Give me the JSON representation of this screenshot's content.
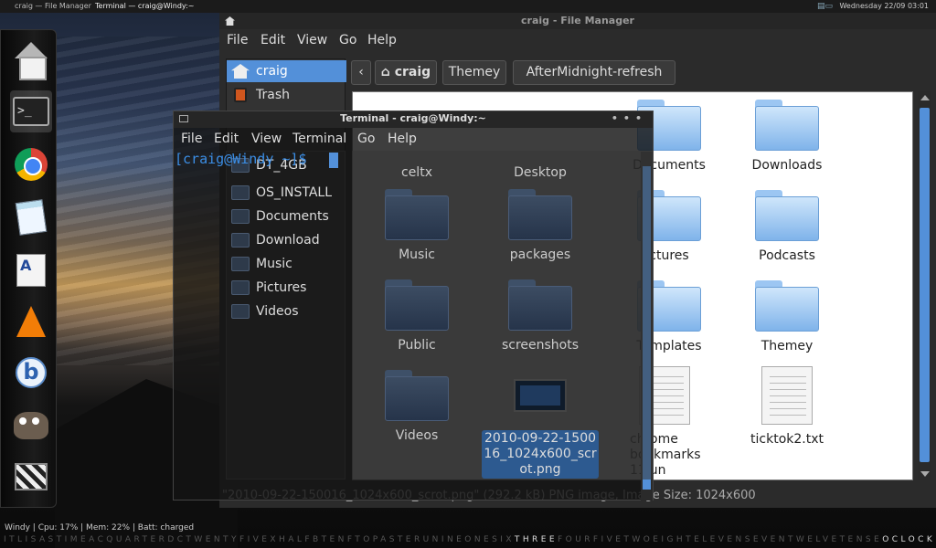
{
  "topbar": {
    "left1": "craig — File Manager",
    "left2": "Terminal — craig@Windy:~",
    "clock": "Wednesday 22/09 03:01"
  },
  "fm": {
    "title": "craig - File Manager",
    "menu": [
      "File",
      "Edit",
      "View",
      "Go",
      "Help"
    ],
    "sidebar": [
      "craig",
      "Trash"
    ],
    "path": {
      "back": "‹",
      "home": "craig",
      "b1": "Themey",
      "b2": "AfterMidnight-refresh"
    },
    "items_top": [
      "Documents",
      "Downloads"
    ],
    "items_row2": [
      "ctures",
      "Podcasts"
    ],
    "items_row3": [
      "Templates",
      "Themey"
    ],
    "item_chrome": "chrome\nbookmarks\n11jun",
    "item_txt": "ticktok2.txt",
    "status": "\"2010-09-22-150016_1024x600_scrot.png\" (292.2 kB) PNG image, Image Size: 1024x600"
  },
  "terminal": {
    "title": "Terminal - craig@Windy:~",
    "menu": [
      "File",
      "Edit",
      "View",
      "Terminal",
      "Go",
      "Help"
    ],
    "prompt": "[craig@Windy ~]$",
    "sidebar": [
      "DT_4GB",
      "OS_INSTALL",
      "Documents",
      "Download",
      "Music",
      "Pictures",
      "Videos"
    ],
    "items": [
      "celtx",
      "Desktop",
      "Music",
      "packages",
      "Public",
      "screenshots",
      "Videos"
    ],
    "selected": "2010-09-22-1500\n16_1024x600_scr\not.png"
  },
  "conky": "Windy |  Cpu: 17%  | Mem: 22%  | Batt: charged",
  "wordclock": {
    "pre": "ITLISASTIMEACQUARTERDCTWENTYFIVEXHALFBTENFTOPASTERUNINEONESIX",
    "hl": "THREE",
    "mid": "FOURFIVETWOEIGHTELEVENSEVENTWELVETENSE",
    "hl2": "OCLOCK"
  }
}
